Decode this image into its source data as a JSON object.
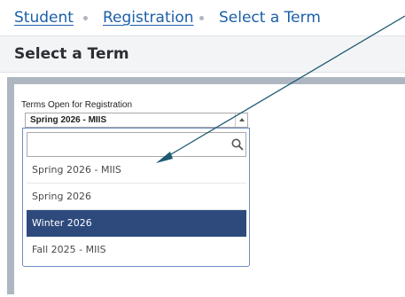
{
  "breadcrumb": {
    "student": "Student",
    "registration": "Registration",
    "current": "Select a Term"
  },
  "page_title": "Select a Term",
  "term_field": {
    "label": "Terms Open for Registration",
    "selected_value": "Spring 2026 - MIIS",
    "search_value": "",
    "options": [
      {
        "label": "Spring 2026 - MIIS"
      },
      {
        "label": "Spring 2026"
      },
      {
        "label": "Winter 2026",
        "highlighted": true
      },
      {
        "label": "Fall 2025 - MIIS"
      }
    ]
  },
  "icons": {
    "search": "search-icon",
    "dropdown_arrow": "chevron-up-icon",
    "annotation": "arrow-icon"
  },
  "colors": {
    "link": "#1b5fa8",
    "highlight": "#2e4a7d",
    "annotation_arrow": "#1e5a73"
  }
}
